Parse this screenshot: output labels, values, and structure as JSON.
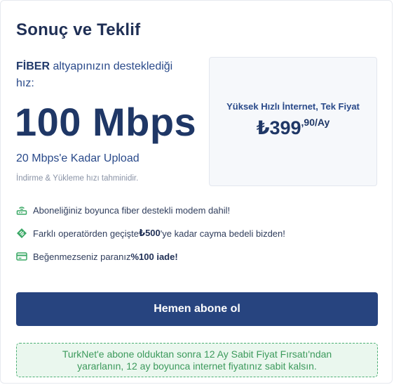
{
  "title": "Sonuç ve Teklif",
  "infrastructure": {
    "type": "FİBER",
    "text": " altyapınızın desteklediği hız:"
  },
  "speed": "100 Mbps",
  "upload": "20 Mbps'e Kadar Upload",
  "estimate_note": "İndirme & Yükleme hızı tahminidir.",
  "offer": {
    "title": "Yüksek Hızlı İnternet, Tek Fiyat",
    "price_main": "₺399",
    "price_suffix": ",90/Ay"
  },
  "features": [
    {
      "icon": "modem-icon",
      "text": "Aboneliğiniz boyunca fiber destekli modem dahil!"
    },
    {
      "icon": "tag-icon",
      "pre": "Farklı operatörden geçişte ",
      "bold": "₺500",
      "post": "'ye kadar cayma bedeli bizden!"
    },
    {
      "icon": "card-icon",
      "pre": "Beğenmezseniz paranız ",
      "bold": "%100 iade!"
    }
  ],
  "cta_label": "Hemen abone ol",
  "notice": "TurkNet'e abone olduktan sonra 12 Ay Sabit Fiyat Fırsatı'ndan yararlanın, 12 ay boyunca internet fiyatınız sabit kalsın.",
  "colors": {
    "primary": "#27447f",
    "success_bg": "#eaf7ee",
    "success_text": "#3c9a5c",
    "icon_green": "#3aa865"
  }
}
